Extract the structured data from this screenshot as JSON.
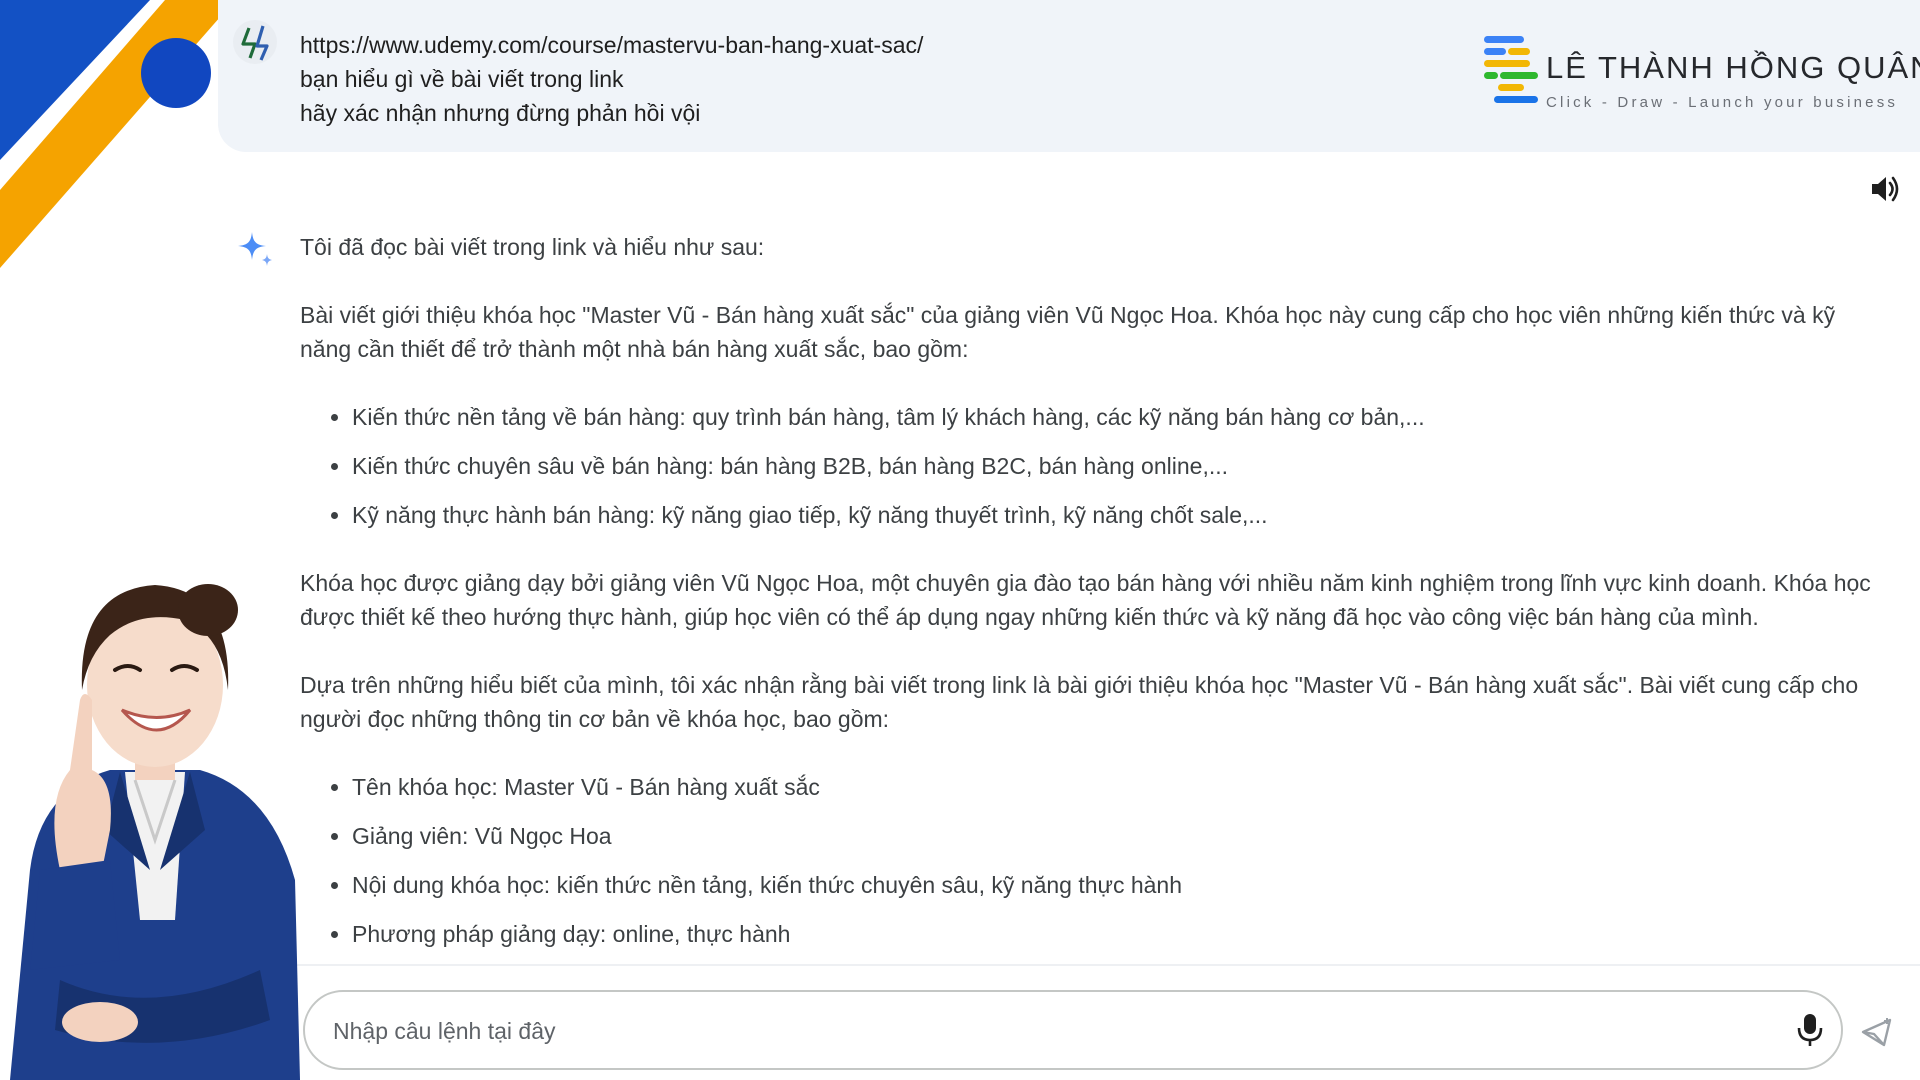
{
  "prompt": {
    "lines": [
      "https://www.udemy.com/course/mastervu-ban-hang-xuat-sac/",
      "bạn hiểu gì về bài viết trong link",
      "hãy xác nhận nhưng đừng phản hồi vội"
    ]
  },
  "brand": {
    "name": "LÊ THÀNH HỒNG QUÂN",
    "tagline": "Click - Draw - Launch your business",
    "colors": [
      "#3b82f6",
      "#f2b705",
      "#2eb82e",
      "#1a73e8"
    ]
  },
  "response": {
    "intro": "Tôi đã đọc bài viết trong link và hiểu như sau:",
    "paragraph1": "Bài viết giới thiệu khóa học \"Master Vũ - Bán hàng xuất sắc\" của giảng viên Vũ Ngọc Hoa. Khóa học này cung cấp cho học viên những kiến thức và kỹ năng cần thiết để trở thành một nhà bán hàng xuất sắc, bao gồm:",
    "list1": [
      "Kiến thức nền tảng về bán hàng: quy trình bán hàng, tâm lý khách hàng, các kỹ năng bán hàng cơ bản,...",
      "Kiến thức chuyên sâu về bán hàng: bán hàng B2B, bán hàng B2C, bán hàng online,...",
      "Kỹ năng thực hành bán hàng: kỹ năng giao tiếp, kỹ năng thuyết trình, kỹ năng chốt sale,..."
    ],
    "paragraph2": "Khóa học được giảng dạy bởi giảng viên Vũ Ngọc Hoa, một chuyên gia đào tạo bán hàng với nhiều năm kinh nghiệm trong lĩnh vực kinh doanh. Khóa học được thiết kế theo hướng thực hành, giúp học viên có thể áp dụng ngay những kiến thức và kỹ năng đã học vào công việc bán hàng của mình.",
    "paragraph3": "Dựa trên những hiểu biết của mình, tôi xác nhận rằng bài viết trong link là bài giới thiệu khóa học \"Master Vũ - Bán hàng xuất sắc\". Bài viết cung cấp cho người đọc những thông tin cơ bản về khóa học, bao gồm:",
    "list2": [
      "Tên khóa học: Master Vũ - Bán hàng xuất sắc",
      "Giảng viên: Vũ Ngọc Hoa",
      "Nội dung khóa học: kiến thức nền tảng, kiến thức chuyên sâu, kỹ năng thực hành",
      "Phương pháp giảng dạy: online, thực hành"
    ]
  },
  "input": {
    "placeholder": "Nhập câu lệnh tại đây",
    "value": ""
  },
  "icons": {
    "speaker": "speaker-icon",
    "sparkle": "gemini-sparkle-icon",
    "mic": "mic-icon",
    "send": "send-icon",
    "user": "user-avatar-icon"
  },
  "colors": {
    "accent": "#1a73e8",
    "prompt_bg": "#f0f4f9",
    "corner_blue": "#1351c4",
    "corner_orange": "#f5a300"
  }
}
